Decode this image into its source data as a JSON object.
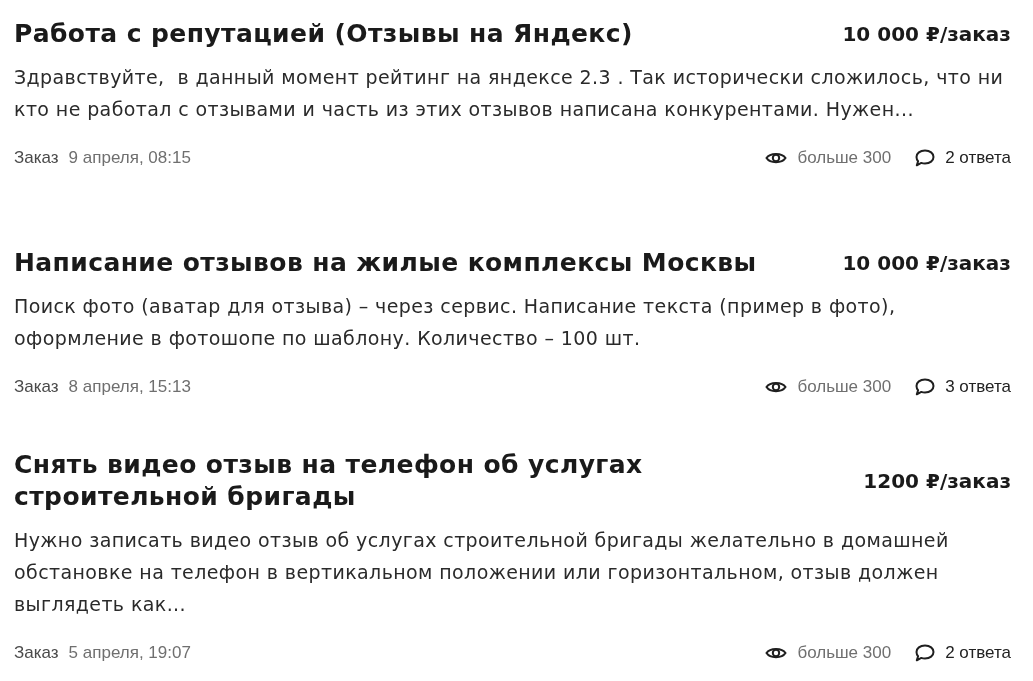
{
  "orders": [
    {
      "title": "Работа с репутацией (Отзывы на Яндекс)",
      "price": "10 000 ₽/заказ",
      "description": "Здравствуйте,  в данный момент рейтинг на яндексе 2.3 . Так исторически сложилось, что ни кто не работал с отзывами и часть из этих отзывов написана конкурентами. Нужен...",
      "label": "Заказ",
      "date": "9 апреля, 08:15",
      "views": "больше 300",
      "replies": "2 ответа"
    },
    {
      "title": "Написание отзывов на жилые комплексы Москвы",
      "price": "10 000 ₽/заказ",
      "description": "Поиск фото (аватар для отзыва) – через сервис. Написание текста (пример в фото), оформление в фотошопе по шаблону. Количество – 100 шт.",
      "label": "Заказ",
      "date": "8 апреля, 15:13",
      "views": "больше 300",
      "replies": "3 ответа"
    },
    {
      "title": "Снять видео отзыв на телефон об услугах строительной бригады",
      "price": "1200 ₽/заказ",
      "description": "Нужно записать видео отзыв об услугах строительной бригады желательно в домашней обстановке на телефон в вертикальном положении или горизонтальном, отзыв должен выглядеть как...",
      "label": "Заказ",
      "date": "5 апреля, 19:07",
      "views": "больше 300",
      "replies": "2 ответа"
    }
  ]
}
